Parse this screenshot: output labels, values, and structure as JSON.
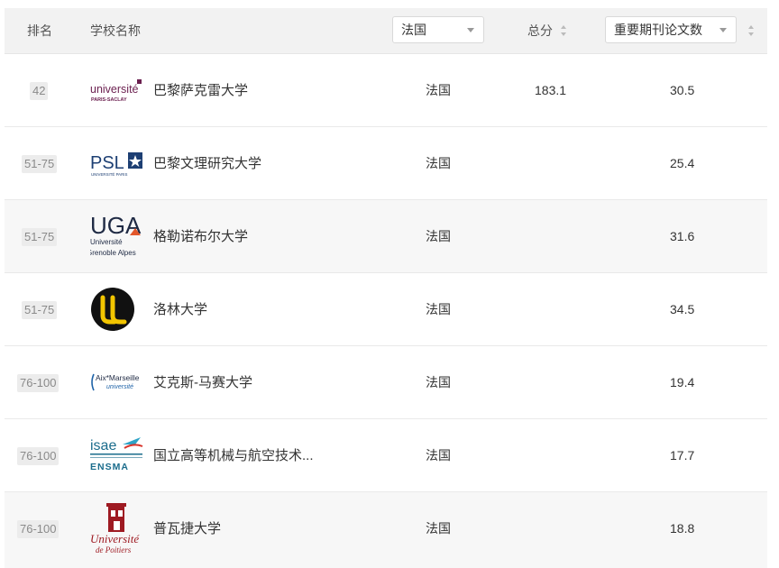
{
  "header": {
    "rank": "排名",
    "school": "学校名称",
    "country_filter": "法国",
    "total": "总分",
    "metric_select": "重要期刊论文数"
  },
  "rows": [
    {
      "rank": "42",
      "name": "巴黎萨克雷大学",
      "country": "法国",
      "total": "183.1",
      "journal": "30.5",
      "logo": "universite-paris-saclay-logo"
    },
    {
      "rank": "51-75",
      "name": "巴黎文理研究大学",
      "country": "法国",
      "total": "",
      "journal": "25.4",
      "logo": "psl-logo"
    },
    {
      "rank": "51-75",
      "name": "格勒诺布尔大学",
      "country": "法国",
      "total": "",
      "journal": "31.6",
      "logo": "uga-logo"
    },
    {
      "rank": "51-75",
      "name": "洛林大学",
      "country": "法国",
      "total": "",
      "journal": "34.5",
      "logo": "universite-de-lorraine-logo"
    },
    {
      "rank": "76-100",
      "name": "艾克斯-马赛大学",
      "country": "法国",
      "total": "",
      "journal": "19.4",
      "logo": "aix-marseille-logo"
    },
    {
      "rank": "76-100",
      "name": "国立高等机械与航空技术...",
      "country": "法国",
      "total": "",
      "journal": "17.7",
      "logo": "isae-ensma-logo"
    },
    {
      "rank": "76-100",
      "name": "普瓦捷大学",
      "country": "法国",
      "total": "",
      "journal": "18.8",
      "logo": "universite-de-poitiers-logo"
    }
  ],
  "logo_text": {
    "saclay_main": "université",
    "saclay_sub": "PARIS-SACLAY",
    "psl_main": "PSL",
    "psl_sub": "UNIVERSITÉ PARIS",
    "uga_main": "UGA",
    "uga_sub1": "Université",
    "uga_sub2": "Grenoble Alpes",
    "aix_main": "Aix*Marseille",
    "aix_sub": "université",
    "isae_main": "isae",
    "isae_sub": "ENSMA",
    "poitiers_main": "Université",
    "poitiers_sub": "de Poitiers"
  },
  "colors": {
    "header_bg": "#f2f2f2",
    "alt_row_bg": "#f7f7f7",
    "rank_badge_bg": "#ececec",
    "saclay": "#6b1f4f",
    "psl": "#1d3f73",
    "uga": "#1f2a44",
    "uga_accent": "#e2572b",
    "lorraine_yellow": "#f2c500",
    "aix": "#1f63a8",
    "isae": "#1b6c8c",
    "poitiers": "#9e1a22"
  }
}
